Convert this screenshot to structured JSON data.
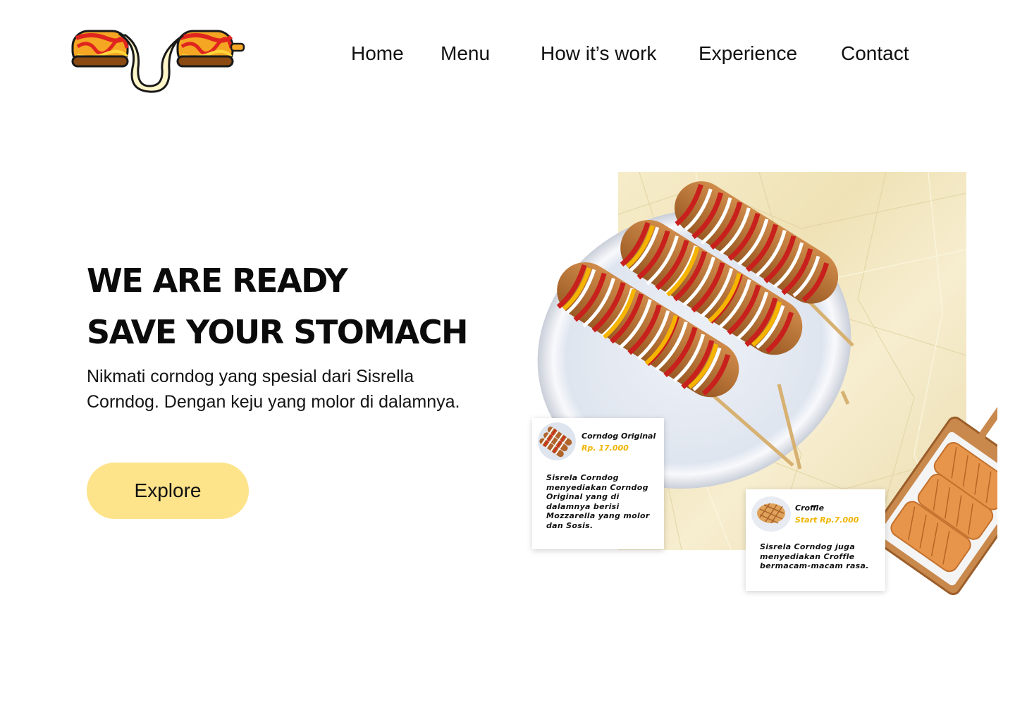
{
  "nav": {
    "items": [
      {
        "label": "Home"
      },
      {
        "label": "Menu"
      },
      {
        "label": "How it’s work"
      },
      {
        "label": "Experience"
      },
      {
        "label": "Contact"
      }
    ]
  },
  "hero": {
    "title_line1": "WE ARE READY",
    "title_line2": "SAVE YOUR STOMACH",
    "description": "Nikmati corndog yang spesial dari Sisrella Corndog. Dengan keju yang molor di dalamnya.",
    "cta_label": "Explore"
  },
  "products": [
    {
      "name": "Corndog Original",
      "price": "Rp. 17.000",
      "description": "Sisrela Corndog menyediakan Corndog Original yang di dalamnya berisi Mozzarella yang molor dan Sosis."
    },
    {
      "name": "Croffle",
      "price": "Start Rp.7.000",
      "description": "Sisrela Corndog juga menyediakan Croffle bermacam-macam rasa."
    }
  ],
  "colors": {
    "accent_button": "#fde38a",
    "price_text": "#f0b400",
    "paper_background": "#f3e8c2",
    "heading_text": "#0b0b0b"
  },
  "icons": {
    "logo": "corndog-cheese-pull-logo"
  }
}
